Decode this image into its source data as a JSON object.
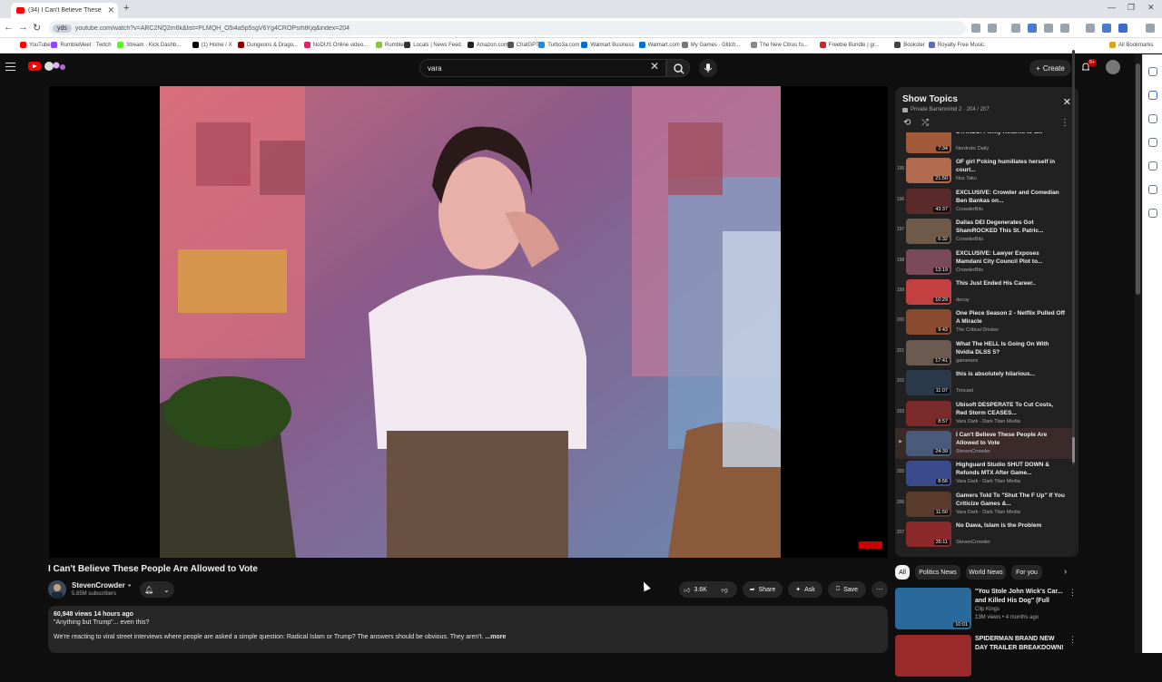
{
  "browser": {
    "tab_title": "(34) I Can't Believe These P...",
    "url": "youtube.com/watch?v=ARC2NQ2m6k&list=PLMQH_O5i4a5p5sgV6Yg4CROPsrhtKjq&index=204",
    "bookmarks": [
      {
        "label": "YouTube",
        "color": "#ff0000"
      },
      {
        "label": "RumbleMeet · Twitch",
        "color": "#9146ff"
      },
      {
        "label": "Stream · Kick Dashb...",
        "color": "#53fc18"
      },
      {
        "label": "(1) Home / X",
        "color": "#000000"
      },
      {
        "label": "Dungeons & Drago...",
        "color": "#8b0000"
      },
      {
        "label": "NoDUS Online video...",
        "color": "#e91e63"
      },
      {
        "label": "Rumble",
        "color": "#85c742"
      },
      {
        "label": "Locals | News Feed",
        "color": "#333333"
      },
      {
        "label": "Amazon.com",
        "color": "#222222"
      },
      {
        "label": "ChatGPT",
        "color": "#555555"
      },
      {
        "label": "Turbo3a.com",
        "color": "#1e88e5"
      },
      {
        "label": "Walmart Business",
        "color": "#0071ce"
      },
      {
        "label": "Walmart.com",
        "color": "#0071ce"
      },
      {
        "label": "My Games · Glitch...",
        "color": "#777777"
      },
      {
        "label": "The New Citrus fo...",
        "color": "#888888"
      },
      {
        "label": "Freebie Bundle | gr...",
        "color": "#c62828"
      },
      {
        "label": "Bookster",
        "color": "#444444"
      },
      {
        "label": "Royalty Free Music",
        "color": "#5c6bc0"
      }
    ],
    "all_bookmarks": "All Bookmarks"
  },
  "header": {
    "search_value": "vara",
    "create_label": "Create",
    "notif_count": "9+"
  },
  "video": {
    "title": "I Can't Believe These People Are Allowed to Vote",
    "channel": "StevenCrowder",
    "subscribers": "5.85M subscribers",
    "likes": "3.6K",
    "share": "Share",
    "ask": "Ask",
    "save": "Save",
    "stats": "60,948 views  14 hours ago",
    "tagline": "\"Anything but Trump\"... even this?",
    "description": "We're reacting to viral street interviews where people are asked a simple question: Radical Islam or Trump? The answers should be obvious. They aren't.",
    "more": "...more"
  },
  "playlist": {
    "title": "Show Topics",
    "subtitle": "Private  Barrenmind 2 · 204 / 207",
    "items": [
      {
        "idx": "",
        "title": "STANDS: Plenty Returns to d...",
        "channel": "Nerdrotic Daily",
        "duration": "7:34",
        "color": "#a05a3a"
      },
      {
        "idx": "195",
        "title": "OF girl f*cking humiliates herself in court...",
        "channel": "Nux Taku",
        "duration": "21:50",
        "color": "#b36b4f"
      },
      {
        "idx": "196",
        "title": "EXCLUSIVE: Crowder and Comedian Ben Bankas on...",
        "channel": "CrowderBits",
        "duration": "43:37",
        "color": "#5a2a2a"
      },
      {
        "idx": "197",
        "title": "Dallas DEI Degenerates Got ShamROCKED This St. Patric...",
        "channel": "CrowderBits",
        "duration": "6:32",
        "color": "#6f5a4a"
      },
      {
        "idx": "198",
        "title": "EXCLUSIVE: Lawyer Exposes Mamdani City Council Plot to...",
        "channel": "CrowderBits",
        "duration": "13:19",
        "color": "#7a4a5a"
      },
      {
        "idx": "199",
        "title": "This Just Ended His Career..",
        "channel": "decoy",
        "duration": "10:29",
        "color": "#c24040"
      },
      {
        "idx": "200",
        "title": "One Piece Season 2 - Netflix Pulled Off A Miracle",
        "channel": "The Critical Drinker",
        "duration": "9:43",
        "color": "#8a4a30"
      },
      {
        "idx": "201",
        "title": "What The HELL Is Going On With Nvidia DLSS 5?",
        "channel": "gameranx",
        "duration": "17:41",
        "color": "#6a5a50"
      },
      {
        "idx": "202",
        "title": "this is absolutely hilarious...",
        "channel": "Timcast",
        "duration": "11:07",
        "color": "#2a3a4a"
      },
      {
        "idx": "203",
        "title": "Ubisoft DESPERATE To Cut Costs, Red Storm CEASES...",
        "channel": "Vara Dark - Dark Titan Media",
        "duration": "8:57",
        "color": "#7a2a2a"
      },
      {
        "idx": "▶",
        "title": "I Can't Believe These People Are Allowed to Vote",
        "channel": "StevenCrowder",
        "duration": "24:39",
        "color": "#4a5a7a"
      },
      {
        "idx": "205",
        "title": "Highguard Studio SHUT DOWN & Refunds MTX After Game...",
        "channel": "Vara Dark - Dark Titan Media",
        "duration": "8:56",
        "color": "#3a4a8a"
      },
      {
        "idx": "206",
        "title": "Gamers Told To \"Shut The F Up\" If You Criticize Games &...",
        "channel": "Vara Dark - Dark Titan Media",
        "duration": "11:50",
        "color": "#5a3a2a"
      },
      {
        "idx": "207",
        "title": "No Dawa, Islam is the Problem",
        "channel": "StevenCrowder",
        "duration": "35:11",
        "color": "#8a2a2a"
      }
    ],
    "active_index": 10
  },
  "chips": [
    "All",
    "Politics News",
    "World News",
    "For you"
  ],
  "recommendations": [
    {
      "title": "\"You Stole John Wick's Car... and Killed His Dog\" (Full Scen...",
      "channel": "Clip Kings",
      "meta": "13M views • 4 months ago",
      "duration": "10:01",
      "color": "#2a6a9a"
    },
    {
      "title": "SPIDERMAN BRAND NEW DAY TRAILER BREAKDOWN! Every ...",
      "channel": "",
      "meta": "",
      "duration": "",
      "color": "#9a2a2a"
    }
  ],
  "colors": {
    "yt_red": "#ff0000",
    "bg": "#0f0f0f",
    "panel": "#212121",
    "active_row": "#3b2a2a"
  }
}
